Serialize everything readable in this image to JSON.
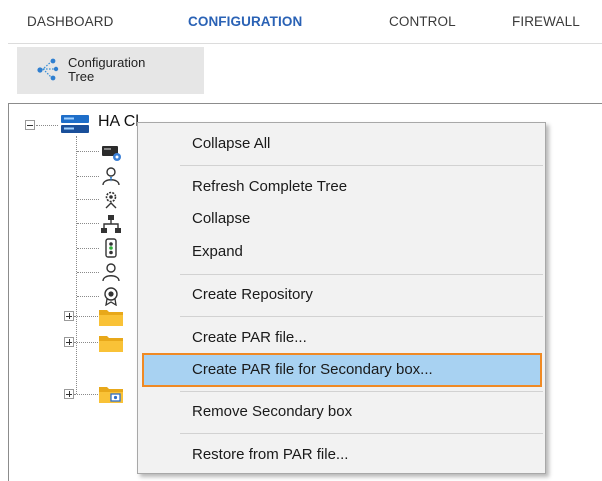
{
  "nav": {
    "tabs": [
      {
        "label": "DASHBOARD",
        "active": false
      },
      {
        "label": "CONFIGURATION",
        "active": true
      },
      {
        "label": "CONTROL",
        "active": false
      },
      {
        "label": "FIREWALL",
        "active": false
      }
    ],
    "active_color": "#2a62b5",
    "inactive_color": "#3a3a3a"
  },
  "toolbar": {
    "config_tree_line1": "Configuration",
    "config_tree_line2": "Tree",
    "icon": "tree-network-icon"
  },
  "tree": {
    "root_label": "HA Cl",
    "root_icon": "server-icon",
    "child_icons": [
      "box-settings-icon",
      "admin-user-icon",
      "service-gear-icon",
      "network-hierarchy-icon",
      "traffic-light-icon",
      "user-icon",
      "certificate-icon",
      "folder-icon",
      "folder-icon",
      "folder-box-icon"
    ]
  },
  "context_menu": {
    "items": [
      {
        "label": "Collapse All"
      },
      {
        "label": "Refresh Complete Tree"
      },
      {
        "label": "Collapse"
      },
      {
        "label": "Expand"
      },
      {
        "label": "Create Repository"
      },
      {
        "label": "Create PAR file..."
      },
      {
        "label": "Create PAR file for Secondary box...",
        "highlighted": true
      },
      {
        "label": "Remove Secondary box"
      },
      {
        "label": "Restore from PAR file..."
      }
    ],
    "highlight_fill": "#a8d2f2",
    "highlight_border": "#f08a24"
  }
}
